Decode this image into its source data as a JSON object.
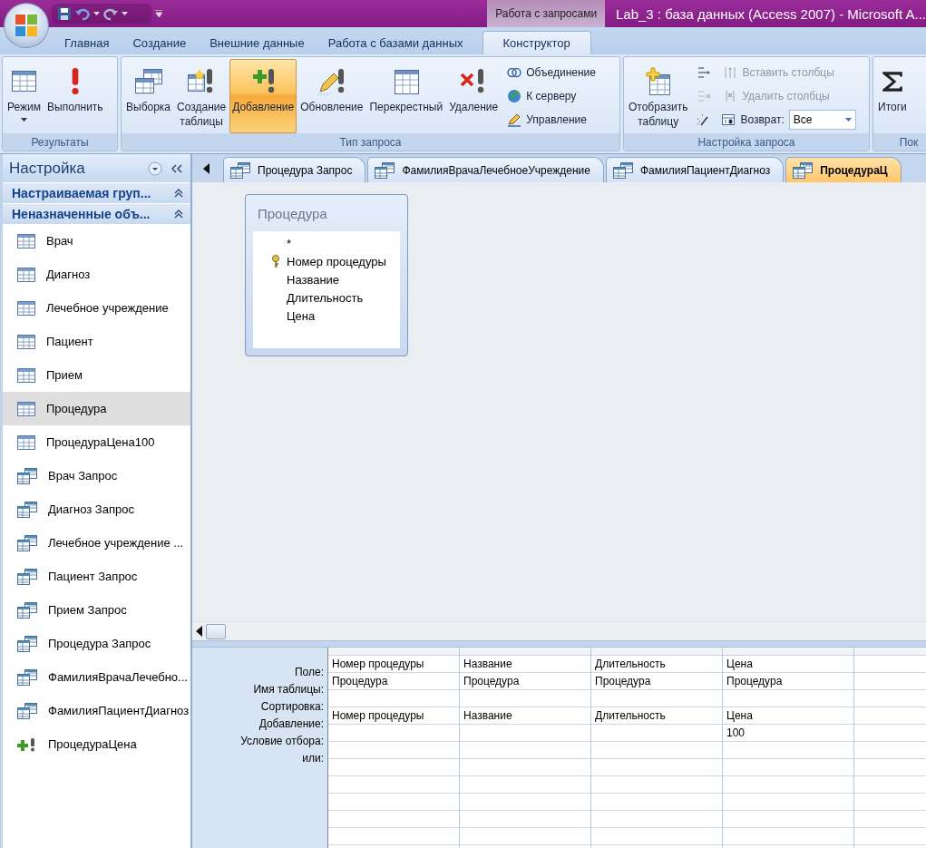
{
  "window": {
    "title": "Lab_3 : база данных (Access 2007) - Microsoft A..."
  },
  "contextual_tab": "Работа с запросами",
  "ribbon": {
    "tabs": [
      {
        "label": "Главная",
        "selected": false
      },
      {
        "label": "Создание",
        "selected": false
      },
      {
        "label": "Внешние данные",
        "selected": false
      },
      {
        "label": "Работа с базами данных",
        "selected": false
      },
      {
        "label": "Конструктор",
        "selected": true
      }
    ],
    "groups": [
      {
        "label": "Результаты",
        "items": [
          {
            "kind": "large",
            "label": "Режим",
            "dropdown": true,
            "selected": false
          },
          {
            "kind": "large",
            "label": "Выполнить",
            "selected": false
          }
        ]
      },
      {
        "label": "Тип запроса",
        "items": [
          {
            "kind": "large",
            "label": "Выборка",
            "selected": false
          },
          {
            "kind": "large",
            "label": "Создание\nтаблицы",
            "selected": false
          },
          {
            "kind": "large",
            "label": "Добавление",
            "selected": true
          },
          {
            "kind": "large",
            "label": "Обновление",
            "selected": false
          },
          {
            "kind": "large",
            "label": "Перекрестный",
            "selected": false
          },
          {
            "kind": "large",
            "label": "Удаление",
            "selected": false
          },
          {
            "kind": "small",
            "label": "Объединение",
            "disabled": false
          },
          {
            "kind": "small",
            "label": "К серверу",
            "disabled": false
          },
          {
            "kind": "small",
            "label": "Управление",
            "disabled": false
          }
        ]
      },
      {
        "label": "Настройка запроса",
        "items": [
          {
            "kind": "large",
            "label": "Отобразить\nтаблицу",
            "selected": false
          },
          {
            "kind": "icon",
            "disabled": false
          },
          {
            "kind": "icon",
            "disabled": true
          },
          {
            "kind": "icon",
            "disabled": false
          },
          {
            "kind": "small",
            "label": "Вставить столбцы",
            "disabled": true
          },
          {
            "kind": "small",
            "label": "Удалить столбцы",
            "disabled": true
          },
          {
            "kind": "combo",
            "label": "Возврат:",
            "value": "Все"
          }
        ]
      },
      {
        "label": "Пок",
        "items": [
          {
            "kind": "large",
            "label": "Итоги",
            "selected": false
          }
        ]
      }
    ]
  },
  "navigation": {
    "title": "Настройка",
    "groups": [
      {
        "label": "Настраиваемая груп..."
      },
      {
        "label": "Неназначенные объ..."
      }
    ],
    "items": [
      {
        "kind": "table",
        "label": "Врач",
        "selected": false
      },
      {
        "kind": "table",
        "label": "Диагноз",
        "selected": false
      },
      {
        "kind": "table",
        "label": "Лечебное учреждение",
        "selected": false
      },
      {
        "kind": "table",
        "label": "Пациент",
        "selected": false
      },
      {
        "kind": "table",
        "label": "Прием",
        "selected": false
      },
      {
        "kind": "table",
        "label": "Процедура",
        "selected": true
      },
      {
        "kind": "table",
        "label": "ПроцедураЦена100",
        "selected": false
      },
      {
        "kind": "query",
        "label": "Врач Запрос",
        "selected": false
      },
      {
        "kind": "query",
        "label": "Диагноз Запрос",
        "selected": false
      },
      {
        "kind": "query",
        "label": "Лечебное учреждение ...",
        "selected": false
      },
      {
        "kind": "query",
        "label": "Пациент Запрос",
        "selected": false
      },
      {
        "kind": "query",
        "label": "Прием Запрос",
        "selected": false
      },
      {
        "kind": "query",
        "label": "Процедура Запрос",
        "selected": false
      },
      {
        "kind": "query",
        "label": "ФамилияВрачаЛечебно...",
        "selected": false
      },
      {
        "kind": "query",
        "label": "ФамилияПациентДиагноз",
        "selected": false
      },
      {
        "kind": "append",
        "label": "ПроцедураЦена",
        "selected": false
      }
    ]
  },
  "document_tabs": [
    {
      "label": "Процедура Запрос",
      "selected": false
    },
    {
      "label": "ФамилияВрачаЛечебноеУчреждение",
      "selected": false
    },
    {
      "label": "ФамилияПациентДиагноз",
      "selected": false
    },
    {
      "label": "ПроцедураЦ",
      "selected": true
    }
  ],
  "table_box": {
    "title": "Процедура",
    "fields": [
      {
        "label": "*",
        "key": false
      },
      {
        "label": "Номер процедуры",
        "key": true
      },
      {
        "label": "Название",
        "key": false
      },
      {
        "label": "Длительность",
        "key": false
      },
      {
        "label": "Цена",
        "key": false
      }
    ]
  },
  "design_grid": {
    "row_labels": [
      "Поле:",
      "Имя таблицы:",
      "Сортировка:",
      "Добавление:",
      "Условие отбора:",
      "или:"
    ],
    "columns": [
      {
        "cells": [
          "Номер процедуры",
          "Процедура",
          null,
          "Номер процедуры"
        ]
      },
      {
        "cells": [
          "Название",
          "Процедура",
          null,
          "Название"
        ]
      },
      {
        "cells": [
          "Длительность",
          "Процедура",
          null,
          "Длительность"
        ]
      },
      {
        "cells": [
          "Цена",
          "Процедура",
          null,
          "Цена",
          "100"
        ]
      }
    ]
  }
}
